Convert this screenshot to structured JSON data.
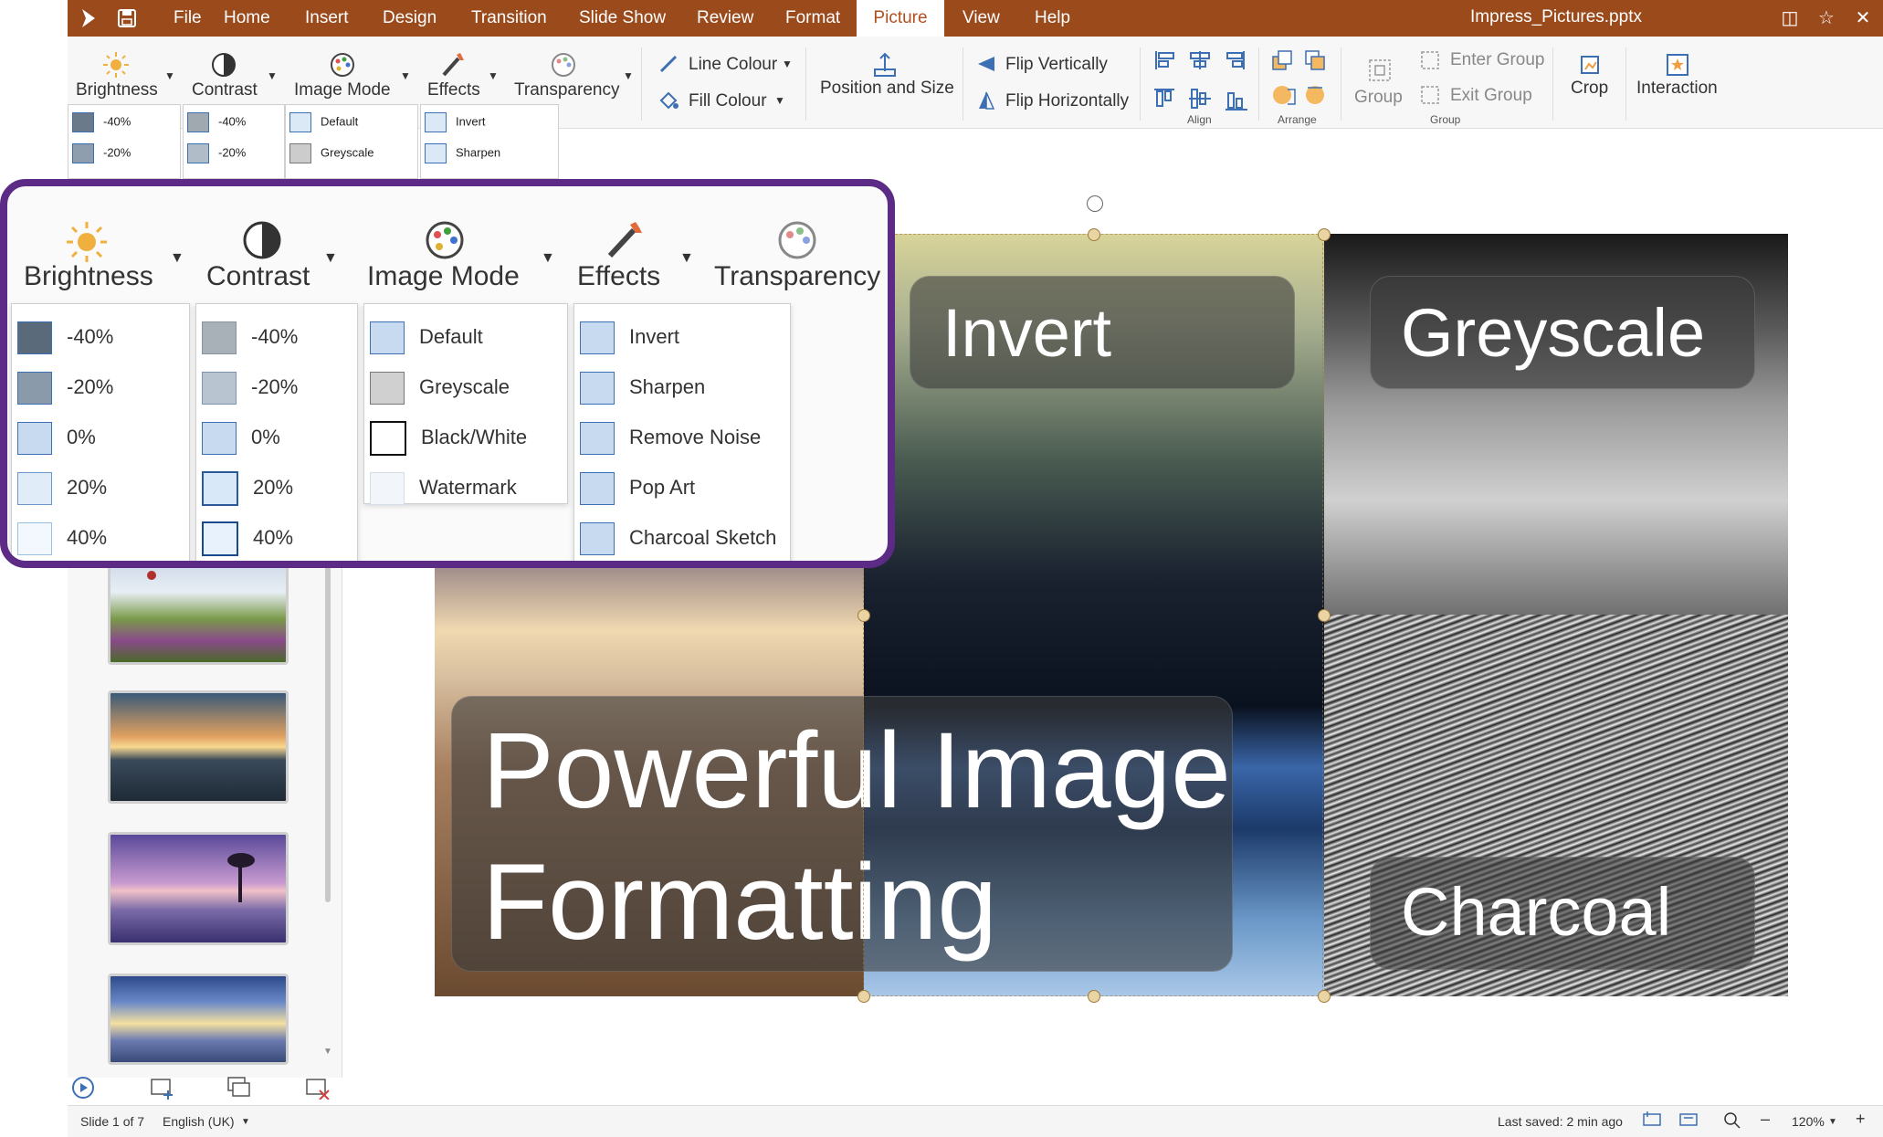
{
  "app": {
    "document_title": "Impress_Pictures.pptx"
  },
  "menu": {
    "items": [
      "File",
      "Home",
      "Insert",
      "Design",
      "Transition",
      "Slide Show",
      "Review",
      "Format",
      "Picture",
      "View",
      "Help"
    ],
    "active": "Picture"
  },
  "ribbon": {
    "brightness": "Brightness",
    "contrast": "Contrast",
    "image_mode": "Image Mode",
    "effects": "Effects",
    "transparency": "Transparency",
    "line_colour": "Line Colour",
    "fill_colour": "Fill Colour",
    "position_size": "Position and Size",
    "flip_vertically": "Flip Vertically",
    "flip_horizontally": "Flip Horizontally",
    "align": "Align",
    "arrange": "Arrange",
    "group": "Group",
    "enter_group": "Enter Group",
    "exit_group": "Exit Group",
    "group_section": "Group",
    "crop": "Crop",
    "interaction": "Interaction"
  },
  "mini_dropdowns": {
    "brightness": [
      "-40%",
      "-20%"
    ],
    "contrast": [
      "-40%",
      "-20%"
    ],
    "image_mode": [
      "Default",
      "Greyscale"
    ],
    "effects": [
      "Invert",
      "Sharpen"
    ]
  },
  "zoom_panel": {
    "brightness_label": "Brightness",
    "contrast_label": "Contrast",
    "image_mode_label": "Image Mode",
    "effects_label": "Effects",
    "transparency_label": "Transparency",
    "brightness_items": [
      "-40%",
      "-20%",
      "0%",
      "20%",
      "40%"
    ],
    "contrast_items": [
      "-40%",
      "-20%",
      "0%",
      "20%",
      "40%"
    ],
    "image_mode_items": [
      "Default",
      "Greyscale",
      "Black/White",
      "Watermark"
    ],
    "effects_items": [
      "Invert",
      "Sharpen",
      "Remove Noise",
      "Pop Art",
      "Charcoal Sketch"
    ]
  },
  "slide": {
    "title_line1": "Powerful Image",
    "title_line2": "Formatting",
    "label_invert": "Invert",
    "label_greyscale": "Greyscale",
    "label_charcoal": "Charcoal"
  },
  "status": {
    "slide_counter": "Slide 1 of 7",
    "language": "English (UK)",
    "last_saved": "Last saved: 2 min ago",
    "zoom": "120%"
  },
  "colors": {
    "menubar": "#9b4a1c",
    "accent": "#b0501f",
    "zoom_border": "#5c2b86"
  }
}
